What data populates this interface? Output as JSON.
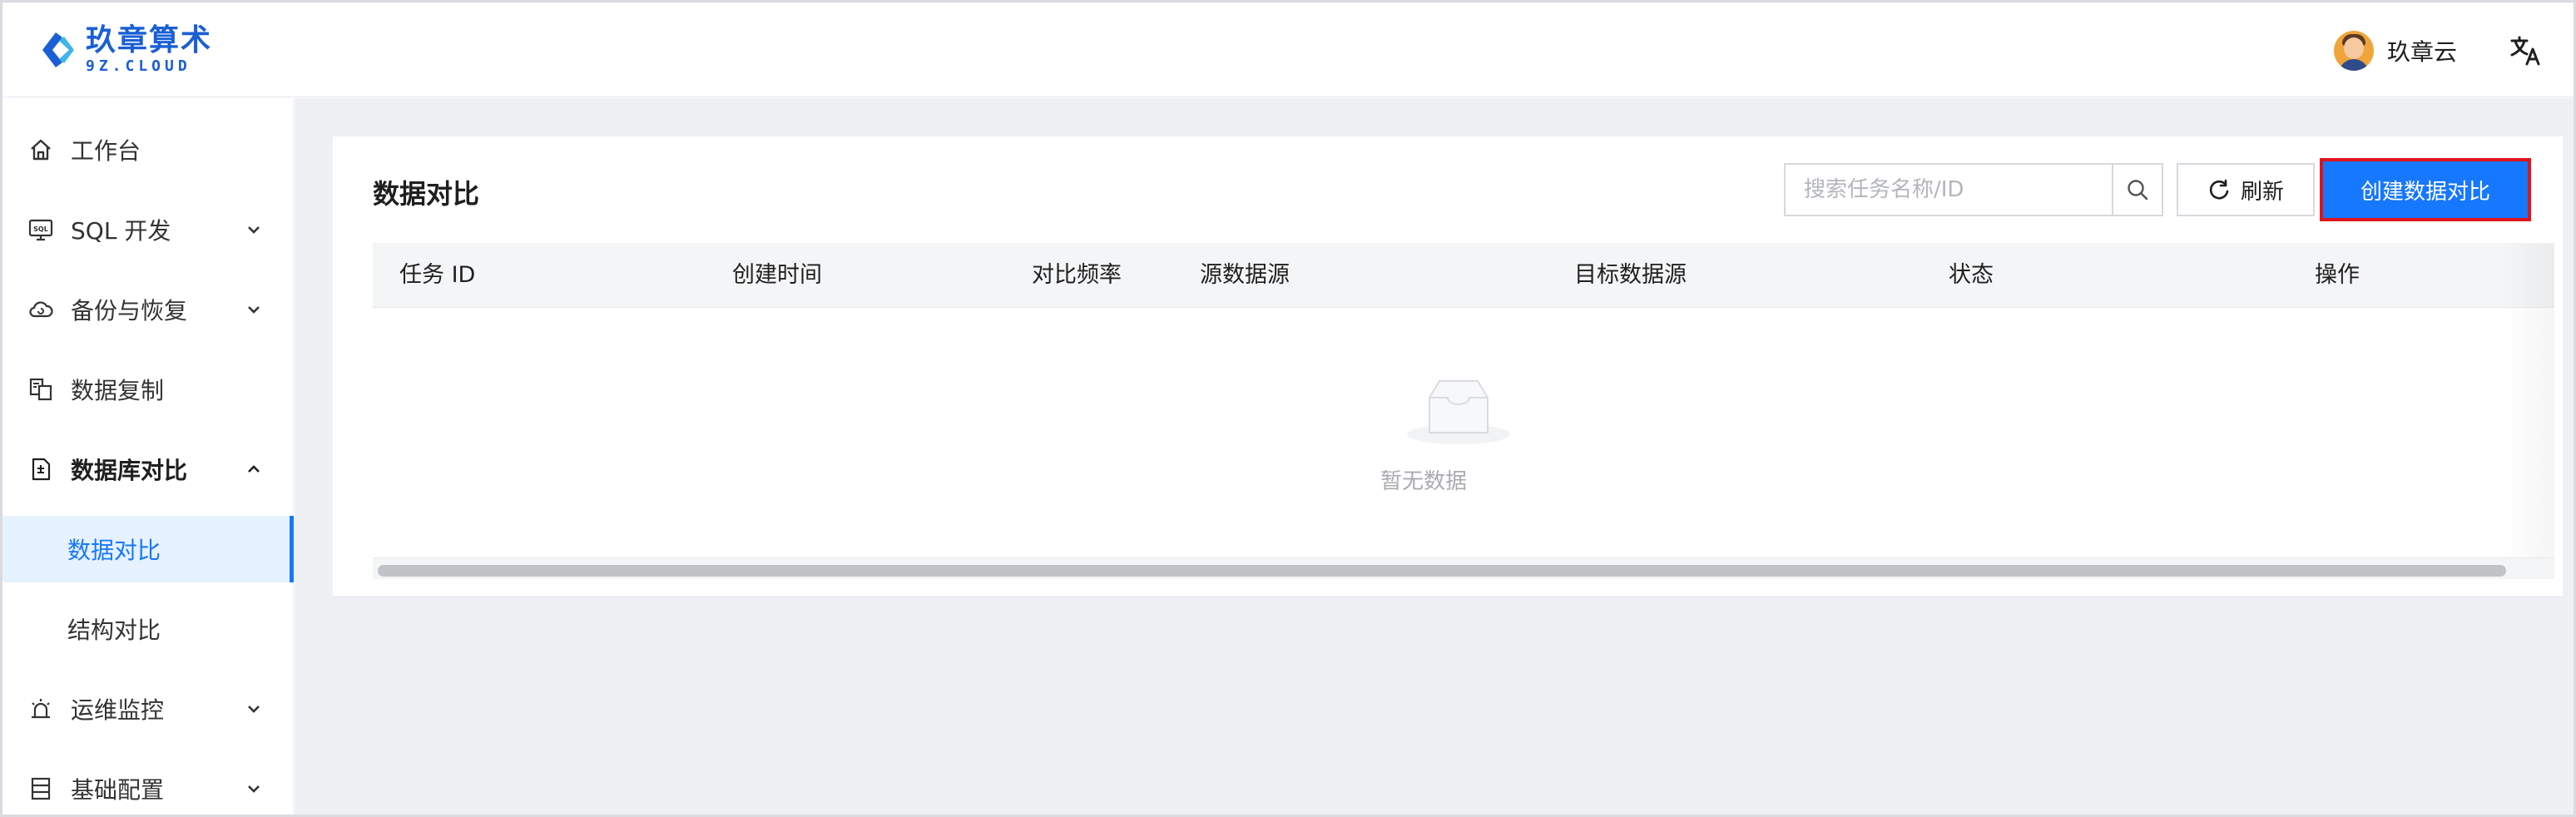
{
  "header": {
    "logo_cn": "玖章算术",
    "logo_en": "9Z.CLOUD",
    "user_name": "玖章云",
    "language_icon": "translate-icon"
  },
  "sidebar": {
    "items": [
      {
        "label": "工作台",
        "icon": "home-icon"
      },
      {
        "label": "SQL 开发",
        "icon": "sql-icon",
        "expandable": true
      },
      {
        "label": "备份与恢复",
        "icon": "cloud-backup-icon",
        "expandable": true
      },
      {
        "label": "数据复制",
        "icon": "copy-icon"
      },
      {
        "label": "数据库对比",
        "icon": "compare-doc-icon",
        "expanded": true
      },
      {
        "label": "运维监控",
        "icon": "alarm-icon",
        "expandable": true
      },
      {
        "label": "基础配置",
        "icon": "config-icon",
        "expandable": true
      }
    ],
    "sub_items": [
      {
        "label": "数据对比",
        "active": true
      },
      {
        "label": "结构对比",
        "active": false
      }
    ]
  },
  "main": {
    "title": "数据对比",
    "search": {
      "placeholder": "搜索任务名称/ID",
      "value": ""
    },
    "refresh_label": "刷新",
    "create_label": "创建数据对比",
    "table": {
      "columns": [
        "任务 ID",
        "创建时间",
        "对比频率",
        "源数据源",
        "目标数据源",
        "状态",
        "操作"
      ],
      "rows": []
    },
    "empty_text": "暂无数据"
  },
  "colors": {
    "accent": "#1677ff",
    "brand": "#1a5fd6",
    "highlight_border": "#e1141b",
    "content_bg": "#eef0f4"
  }
}
